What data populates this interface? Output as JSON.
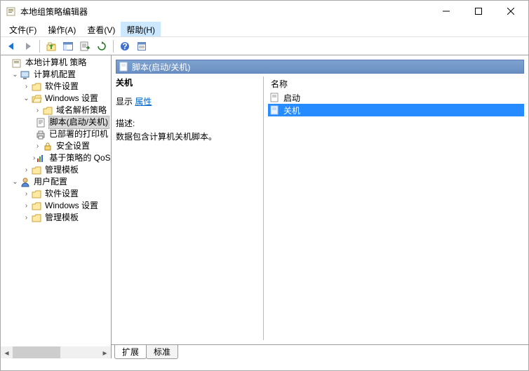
{
  "window": {
    "title": "本地组策略编辑器"
  },
  "menu": {
    "file": "文件(F)",
    "action": "操作(A)",
    "view": "查看(V)",
    "help": "帮助(H)"
  },
  "toolbar_icons": {
    "back": "back-icon",
    "forward": "forward-icon",
    "up": "up-icon",
    "show_hide": "show-hide-tree-icon",
    "export": "export-list-icon",
    "refresh": "refresh-icon",
    "properties": "properties-icon",
    "help": "help-icon"
  },
  "tree": {
    "root": "本地计算机 策略",
    "computer_config": "计算机配置",
    "software_settings": "软件设置",
    "windows_settings": "Windows 设置",
    "dns_policy": "域名解析策略",
    "scripts": "脚本(启动/关机)",
    "deployed_printers": "已部署的打印机",
    "security_settings": "安全设置",
    "policy_based_qos": "基于策略的 QoS",
    "admin_templates_1": "管理模板",
    "user_config": "用户配置",
    "software_settings_2": "软件设置",
    "windows_settings_2": "Windows 设置",
    "admin_templates_2": "管理模板"
  },
  "content": {
    "header": "脚本(启动/关机)",
    "heading": "关机",
    "show_label": "显示",
    "show_link": "属性",
    "desc_label": "描述:",
    "desc_text": "数据包含计算机关机脚本。",
    "column_name": "名称",
    "item_startup": "启动",
    "item_shutdown": "关机"
  },
  "tabs": {
    "extended": "扩展",
    "standard": "标准"
  }
}
